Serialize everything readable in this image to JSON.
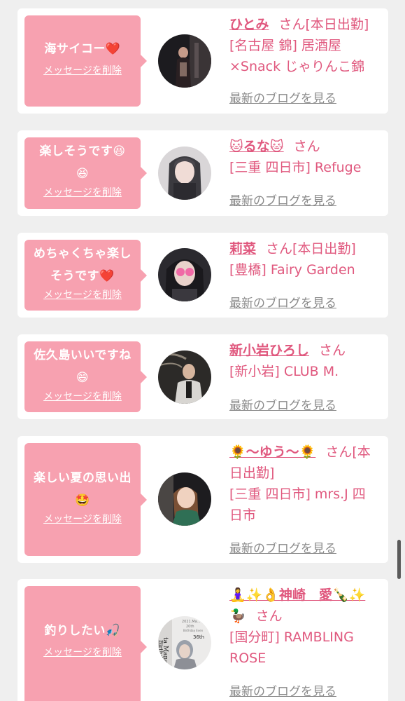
{
  "common": {
    "delete_label": "メッセージを削除",
    "blog_label": "最新のブログを見る",
    "san": "さん",
    "accent_color": "#e0587e",
    "bubble_color": "#f7a1b0"
  },
  "cards": [
    {
      "message_lines": [
        "海サイコー❤️"
      ],
      "name": "ひとみ",
      "suffix": "さん[本日出勤]",
      "shop_lines": [
        "[名古屋 錦] 居酒屋",
        "×Snack じゃりんこ錦"
      ]
    },
    {
      "message_lines": [
        "楽しそうです😆",
        "😆"
      ],
      "name": "🐱るな🐱",
      "suffix": "さん",
      "shop_lines": [
        "[三重 四日市] Refuge"
      ]
    },
    {
      "message_lines": [
        "めちゃくちゃ楽し",
        "そうです❤️"
      ],
      "name": "莉菜",
      "suffix": "さん[本日出勤]",
      "shop_lines": [
        "[豊橋] Fairy Garden"
      ]
    },
    {
      "message_lines": [
        "佐久島いいですね",
        "😄"
      ],
      "name": "新小岩ひろし",
      "suffix": "さん",
      "shop_lines": [
        "[新小岩] CLUB M."
      ]
    },
    {
      "message_lines": [
        "楽しい夏の思い出",
        "🤩"
      ],
      "name": "🌻〜ゆう〜🌻",
      "suffix_lines": [
        "さん[本",
        "日出勤]"
      ],
      "shop_lines": [
        "[三重 四日市] mrs.J 四",
        "日市"
      ]
    },
    {
      "message_lines": [
        "釣りしたい🎣"
      ],
      "name": "🧘‍♀️✨👌神崎　愛🍾✨",
      "suffix_lines": [
        "🦆",
        "さん"
      ],
      "shop_lines": [
        "[国分町] RAMBLING",
        "ROSE"
      ],
      "avatar_text": [
        "2021.Ma...",
        "20th",
        "Birthday Even",
        "36th",
        "ta Mana-",
        "Birthday"
      ]
    }
  ]
}
